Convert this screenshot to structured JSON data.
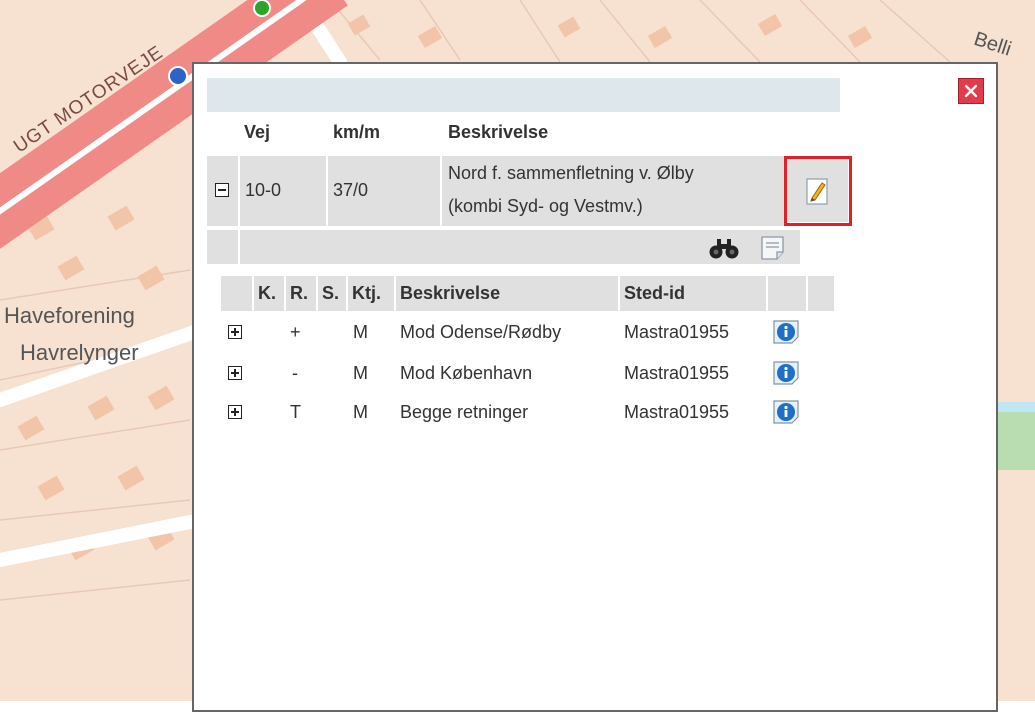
{
  "map": {
    "road_label": "UGT MOTORVEJE",
    "place_label_1": "Haveforening",
    "place_label_2": "Havrelynger",
    "corner_label": "Belli"
  },
  "popup": {
    "columns": {
      "road": "Vej",
      "kmm": "km/m",
      "description": "Beskrivelse"
    },
    "record": {
      "road": "10-0",
      "kmm": "37/0",
      "description_line1": "Nord f. sammenfletning v. Ølby",
      "description_line2": "(kombi Syd- og Vestmv.)"
    },
    "sub_columns": {
      "k": "K.",
      "r": "R.",
      "s": "S.",
      "ktj": "Ktj.",
      "description": "Beskrivelse",
      "sted_id": "Sted-id"
    },
    "sub_rows": [
      {
        "r": "+",
        "ktj": "M",
        "description": "Mod Odense/Rødby",
        "sted_id": "Mastra01955"
      },
      {
        "r": "-",
        "ktj": "M",
        "description": "Mod København",
        "sted_id": "Mastra01955"
      },
      {
        "r": "T",
        "ktj": "M",
        "description": "Begge retninger",
        "sted_id": "Mastra01955"
      }
    ]
  },
  "colors": {
    "highlight": "#e0202a",
    "close": "#e23b4b",
    "row_bg": "#e0e0e0",
    "search_bg": "#dde7ec"
  },
  "icons": [
    "close-icon",
    "edit-icon",
    "binoculars-icon",
    "notes-icon",
    "info-icon",
    "expand-icon",
    "collapse-icon"
  ]
}
